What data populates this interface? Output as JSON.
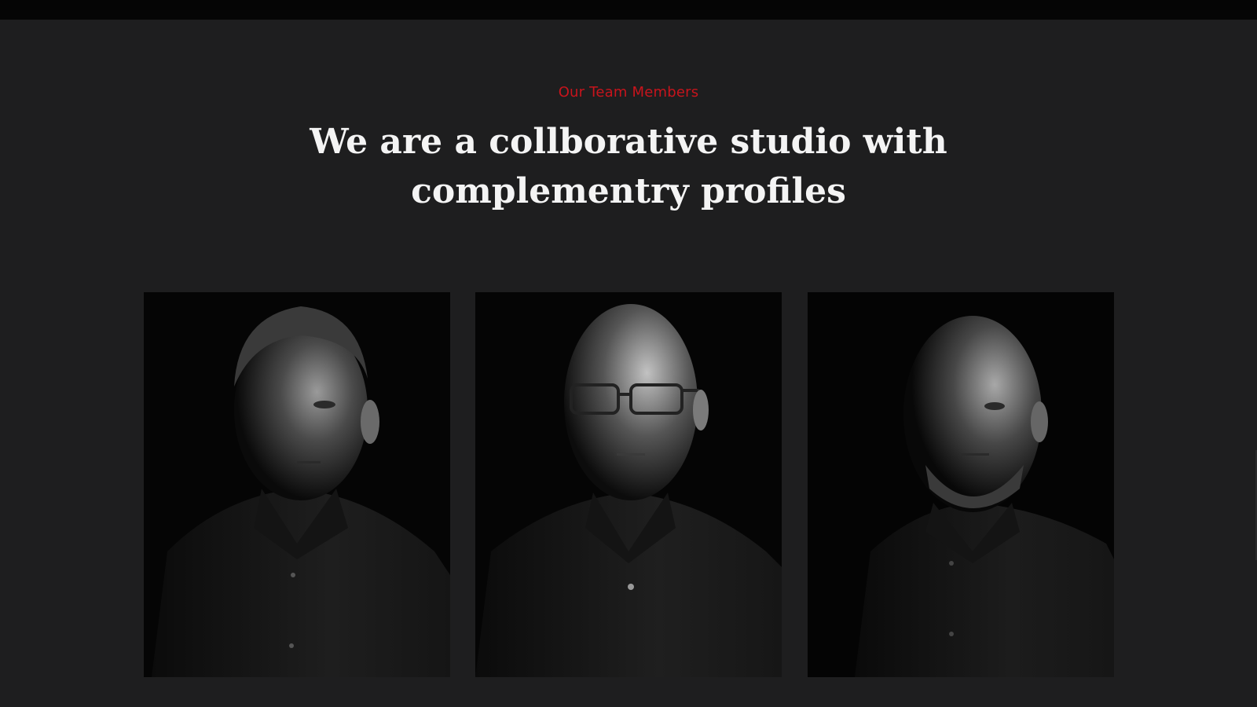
{
  "section": {
    "eyebrow": "Our Team Members",
    "headline_line1": "We are a collborative studio with",
    "headline_line2": "complementry profiles"
  },
  "team_members": [
    {
      "photo": "portrait-1",
      "description": "Man with short hair, dark shirt, low-key lighting"
    },
    {
      "photo": "portrait-2",
      "description": "Bald man with glasses, dark polo"
    },
    {
      "photo": "portrait-3",
      "description": "Bald man with beard, dark shirt"
    }
  ],
  "colors": {
    "accent": "#c8141c",
    "background": "#1e1e1f",
    "topbar": "#050505",
    "heading": "#f4f4f4"
  }
}
